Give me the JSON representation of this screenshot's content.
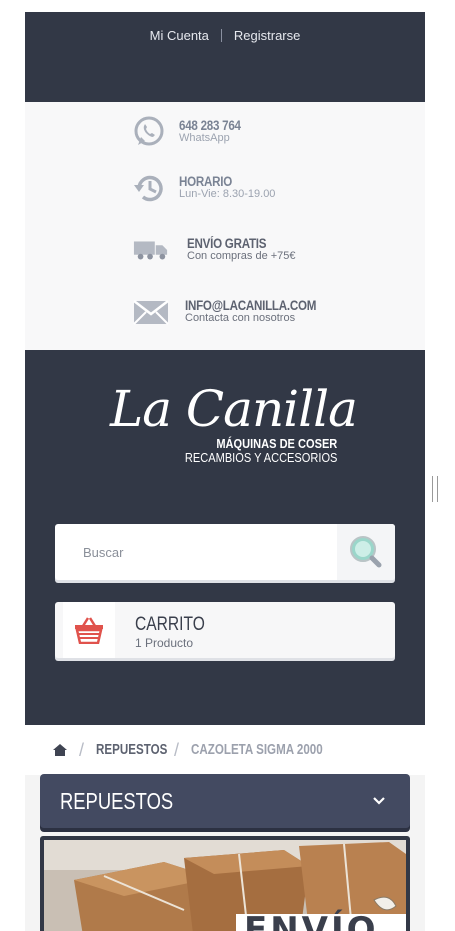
{
  "header": {
    "account_link": "Mi Cuenta",
    "register_link": "Registrarse"
  },
  "info": {
    "whatsapp": {
      "title": "648 283 764",
      "subtitle": "WhatsApp",
      "icon": "whatsapp-icon"
    },
    "schedule": {
      "title": "HORARIO",
      "subtitle": "Lun-Vie: 8.30-19.00",
      "icon": "clock-history-icon"
    },
    "shipping": {
      "title": "ENVÍO GRATIS",
      "subtitle": "Con compras de +75€",
      "icon": "truck-icon"
    },
    "email": {
      "title": "INFO@LACANILLA.COM",
      "subtitle": "Contacta con nosotros",
      "icon": "envelope-icon"
    }
  },
  "brand": {
    "logo_script": "La Canilla",
    "tagline_1": "MÁQUINAS DE COSER",
    "tagline_2": "RECAMBIOS Y ACCESORIOS"
  },
  "search": {
    "placeholder": "Buscar",
    "value": "",
    "icon": "magnifier-icon"
  },
  "cart": {
    "title": "CARRITO",
    "count_text": "1 Producto",
    "icon": "basket-icon"
  },
  "breadcrumb": {
    "home_icon": "home-icon",
    "items": [
      "REPUESTOS",
      "CAZOLETA SIGMA 2000"
    ]
  },
  "category": {
    "title": "REPUESTOS",
    "icon": "chevron-down-icon"
  },
  "banner": {
    "text": "ENVÍO"
  },
  "colors": {
    "dark_navy": "#323846",
    "category_bar": "#434a61",
    "cart_red": "#e0524c",
    "search_teal": "#7ecfc0"
  }
}
